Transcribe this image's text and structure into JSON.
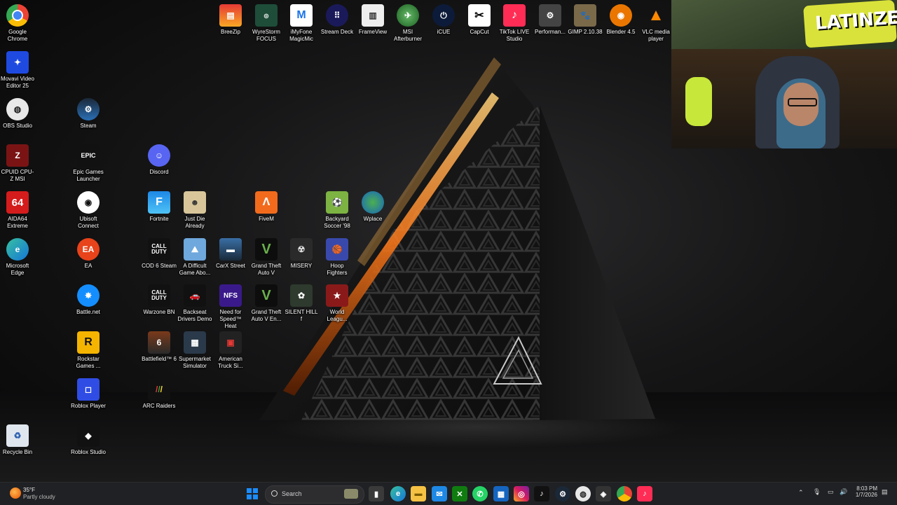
{
  "desktop_icons": {
    "chrome": "Google Chrome",
    "movavi": "Movavi Video Editor 25",
    "obs": "OBS Studio",
    "steam": "Steam",
    "cpuz": "CPUID CPU-Z MSI",
    "epic": "Epic Games Launcher",
    "discord": "Discord",
    "aida": "AIDA64 Extreme",
    "ubisoft": "Ubisoft Connect",
    "fortnite": "Fortnite",
    "justdie": "Just Die Already",
    "fivem": "FiveM",
    "backyard": "Backyard Soccer '98",
    "wplace": "Wplace",
    "edge": "Microsoft Edge",
    "ea": "EA",
    "cod6": "COD 6 Steam",
    "difficult": "A Difficult Game Abo...",
    "carx": "CarX Street",
    "gta": "Grand Theft Auto V",
    "misery": "MISERY",
    "hoop": "Hoop Fighters",
    "battlenet": "Battle.net",
    "warzone": "Warzone BN",
    "backseat": "Backseat Drivers Demo",
    "nfs": "Need for Speed™ Heat",
    "gtaen": "Grand Theft Auto V En...",
    "silenthill": "SILENT HILL f",
    "worldleague": "World Leagu...",
    "rockstar": "Rockstar Games ...",
    "bf6": "Battlefield™ 6",
    "supermarket": "Supermarket Simulator",
    "ats": "American Truck Si...",
    "robloxplayer": "Roblox Player",
    "arc": "ARC Raiders",
    "recycle": "Recycle Bin",
    "robloxstudio": "Roblox Studio",
    "breezip": "BreeZip",
    "wyrestorm": "WyreStorm FOCUS",
    "imyfone": "iMyFone MagicMic",
    "streamdeck": "Stream Deck",
    "frameview": "FrameView",
    "afterburner": "MSI Afterburner",
    "icue": "iCUE",
    "capcut": "CapCut",
    "tiktok": "TikTok LIVE Studio",
    "performance": "Performan...",
    "gimp": "GIMP 2.10.38",
    "blender": "Blender 4.5",
    "vlc": "VLC media player"
  },
  "webcam": {
    "banner_text": "LATINZER"
  },
  "taskbar": {
    "weather_temp": "35°F",
    "weather_desc": "Partly cloudy",
    "search_placeholder": "Search",
    "time": "8:03 PM",
    "date": "1/7/2026",
    "pinned_apps": [
      "file-explorer",
      "edge",
      "folder",
      "mail",
      "xbox",
      "whatsapp",
      "calculator",
      "instagram",
      "tiktok",
      "steam",
      "obs",
      "gta",
      "chrome",
      "tiktok-live"
    ]
  },
  "colors": {
    "taskbar_bg": "#202124",
    "accent_orange": "#ff7a1a",
    "windows_blue": "#1a8cff"
  }
}
